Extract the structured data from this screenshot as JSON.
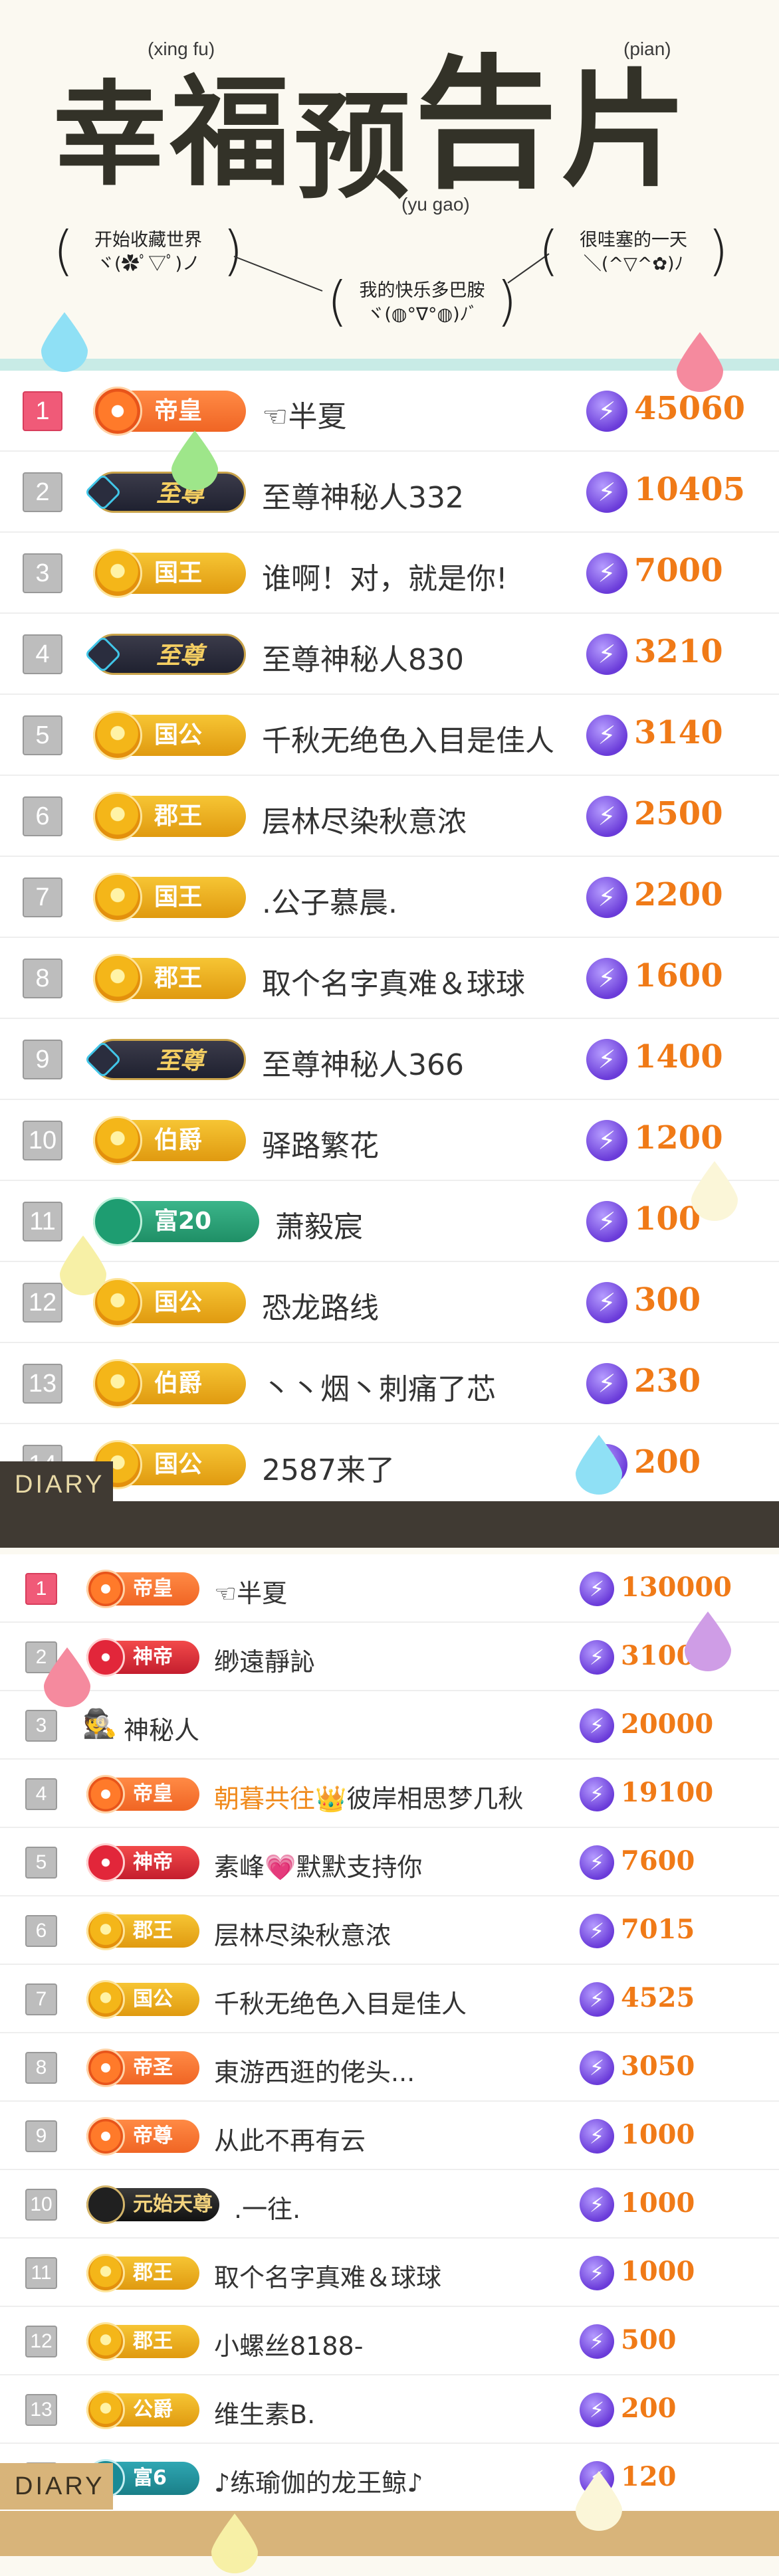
{
  "header": {
    "title_chars": [
      "幸",
      "福",
      "预",
      "告",
      "片"
    ],
    "ruby_xingfu": "(xing fu)",
    "ruby_pian": "(pian)",
    "ruby_yugao": "(yu gao)",
    "bubble_left_line1": "开始收藏世界",
    "bubble_left_line2": "ヾ(✿ﾟ▽ﾟ)ノ",
    "bubble_mid_line1": "我的快乐多巴胺",
    "bubble_mid_line2": "ヾ(◍°∇°◍)ﾉﾞ",
    "bubble_right_line1": "很哇塞的一天",
    "bubble_right_line2": "＼(^▽^✿)ﾉ"
  },
  "ranking1": [
    {
      "rank": "1",
      "badge": "帝皇",
      "style": "orange",
      "name": "☜半夏",
      "value": "45060"
    },
    {
      "rank": "2",
      "badge": "至尊",
      "style": "dark",
      "name": "至尊神秘人332",
      "value": "10405"
    },
    {
      "rank": "3",
      "badge": "国王",
      "style": "gold",
      "name": "谁啊！对，就是你!",
      "value": "7000"
    },
    {
      "rank": "4",
      "badge": "至尊",
      "style": "dark",
      "name": "至尊神秘人830",
      "value": "3210"
    },
    {
      "rank": "5",
      "badge": "国公",
      "style": "gold",
      "name": "千秋无绝色入目是佳人",
      "value": "3140"
    },
    {
      "rank": "6",
      "badge": "郡王",
      "style": "gold",
      "name": "层林尽染秋意浓",
      "value": "2500"
    },
    {
      "rank": "7",
      "badge": "国王",
      "style": "gold",
      "name": ".公子慕晨.",
      "value": "2200"
    },
    {
      "rank": "8",
      "badge": "郡王",
      "style": "gold",
      "name": "取个名字真难＆球球",
      "value": "1600"
    },
    {
      "rank": "9",
      "badge": "至尊",
      "style": "dark",
      "name": "至尊神秘人366",
      "value": "1400"
    },
    {
      "rank": "10",
      "badge": "伯爵",
      "style": "gold",
      "name": "驿路繁花",
      "value": "1200"
    },
    {
      "rank": "11",
      "badge": "富20",
      "style": "green",
      "name": "萧毅宸",
      "value": "100"
    },
    {
      "rank": "12",
      "badge": "国公",
      "style": "gold",
      "name": "恐龙路线",
      "value": "300"
    },
    {
      "rank": "13",
      "badge": "伯爵",
      "style": "gold",
      "name": "丶丶烟丶刺痛了芯",
      "value": "230"
    },
    {
      "rank": "14",
      "badge": "国公",
      "style": "gold",
      "name": "2587来了",
      "value": "200"
    }
  ],
  "ranking2": [
    {
      "rank": "1",
      "badge": "帝皇",
      "style": "orange",
      "name": "☜半夏",
      "value": "130000"
    },
    {
      "rank": "2",
      "badge": "神帝",
      "style": "red",
      "name": "缈遠靜訫",
      "value": "3100"
    },
    {
      "rank": "3",
      "badge": "",
      "style": "none",
      "name": "神秘人",
      "value": "20000"
    },
    {
      "rank": "4",
      "badge": "帝皇",
      "style": "orange",
      "name_hl": "朝暮共往👑",
      "name": "彼岸相思梦几秋",
      "value": "19100"
    },
    {
      "rank": "5",
      "badge": "神帝",
      "style": "red",
      "name": "素峰💗默默支持你",
      "value": "7600"
    },
    {
      "rank": "6",
      "badge": "郡王",
      "style": "gold",
      "name": "层林尽染秋意浓",
      "value": "7015"
    },
    {
      "rank": "7",
      "badge": "国公",
      "style": "gold",
      "name": "千秋无绝色入目是佳人",
      "value": "4525"
    },
    {
      "rank": "8",
      "badge": "帝圣",
      "style": "orange",
      "name": "東游西逛的佬头...",
      "value": "3050"
    },
    {
      "rank": "9",
      "badge": "帝尊",
      "style": "orange",
      "name": "从此不再有云",
      "value": "1000"
    },
    {
      "rank": "10",
      "badge": "元始天尊",
      "style": "black",
      "name": ".一往.",
      "value": "1000"
    },
    {
      "rank": "11",
      "badge": "郡王",
      "style": "gold",
      "name": "取个名字真难＆球球",
      "value": "1000"
    },
    {
      "rank": "12",
      "badge": "郡王",
      "style": "gold",
      "name": "小螺丝8188-",
      "value": "500"
    },
    {
      "rank": "13",
      "badge": "公爵",
      "style": "gold",
      "name": "维生素B.",
      "value": "200"
    },
    {
      "rank": "14",
      "badge": "富6",
      "style": "teal",
      "name": "♪练瑜伽的龙王鲸♪",
      "value": "120"
    }
  ],
  "divider_label": "DIARY",
  "bottom_label": "DIARY",
  "colors": {
    "teal_bar": "#c8ebe6",
    "value_orange": "#f07a17",
    "divider": "#403a33",
    "rank1": "#f05a78"
  }
}
